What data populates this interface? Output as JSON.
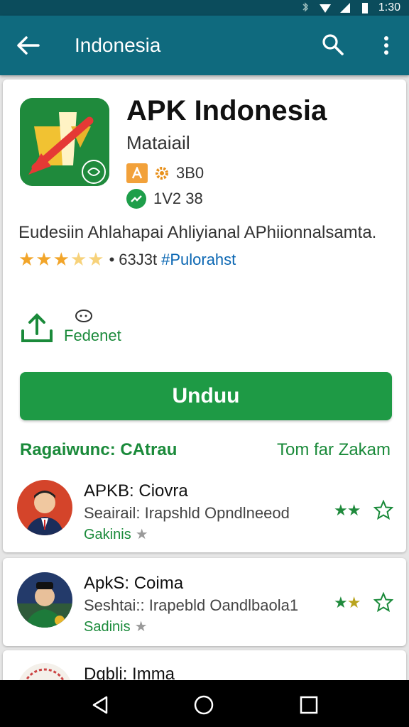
{
  "status_bar": {
    "time": "1:30"
  },
  "app_bar": {
    "title": "Indonesia"
  },
  "app": {
    "name": "APK Indonesia",
    "developer": "Mataiail",
    "size": "3B0",
    "version": "1V2 38",
    "description": "Eudesiin Ahlahapai Ahliyianal APhiionnalsamta.",
    "rating_count": "63J3t",
    "category": "#Pulorahst",
    "share_label": "Fedenet",
    "download_label": "Unduu"
  },
  "section": {
    "title": "Ragaiwunc: CAtrau",
    "more": "Tom far Zakam"
  },
  "list": [
    {
      "title": "APKB: Ciovra",
      "subtitle": "Seairail: Irapshld Opndlneeod",
      "tag": "Gakinis"
    },
    {
      "title": "ApkS: Coima",
      "subtitle": "Seshtai:: Irapebld Oandlbaola1",
      "tag": "Sadinis"
    },
    {
      "title": "Dqbli: Imma"
    }
  ],
  "colors": {
    "app_bar": "#0f6a7e",
    "status_bar": "#0b4c5c",
    "accent_green": "#1e9a45",
    "link_blue": "#0b67b3"
  }
}
